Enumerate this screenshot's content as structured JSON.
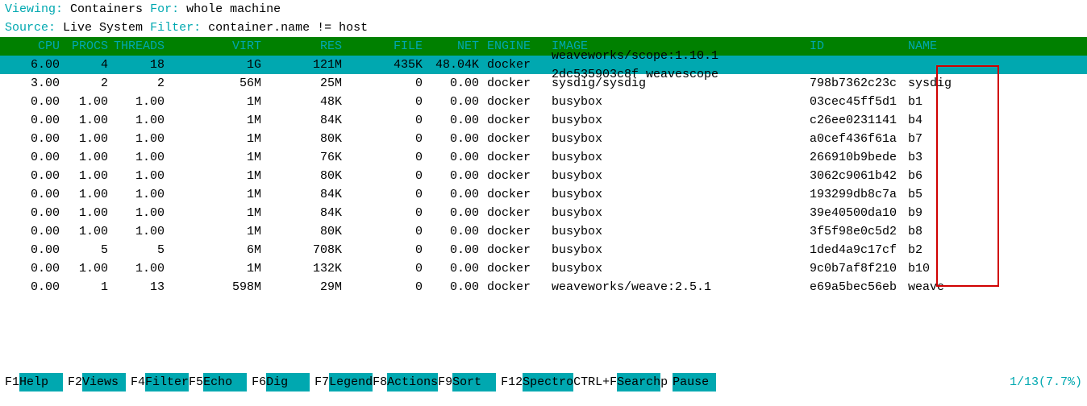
{
  "top": {
    "viewing_label": "Viewing:",
    "viewing_value": "Containers",
    "for_label": "For:",
    "for_value": "whole machine",
    "source_label": "Source:",
    "source_value": "Live System",
    "filter_label": "Filter:",
    "filter_value": "container.name != host"
  },
  "headers": {
    "cpu": "CPU",
    "procs": "PROCS",
    "threads": "THREADS",
    "virt": "VIRT",
    "res": "RES",
    "file": "FILE",
    "net": "NET",
    "engine": "ENGINE",
    "image": "IMAGE",
    "id": "ID",
    "name": "NAME"
  },
  "selected": {
    "cpu": "6.00",
    "procs": "4",
    "threads": "18",
    "virt": "1G",
    "res": "121M",
    "file": "435K",
    "netfile": "48.04K",
    "engine": "docker",
    "image": "weaveworks/scope:1.10.1",
    "id": "2dc535903c8f",
    "name": "weavescope"
  },
  "rows": [
    {
      "cpu": "3.00",
      "procs": "2",
      "threads": "2",
      "virt": "56M",
      "res": "25M",
      "file": "0",
      "net": "0.00",
      "engine": "docker",
      "image": "sysdig/sysdig",
      "id": "798b7362c23c",
      "name": "sysdig"
    },
    {
      "cpu": "0.00",
      "procs": "1.00",
      "threads": "1.00",
      "virt": "1M",
      "res": "48K",
      "file": "0",
      "net": "0.00",
      "engine": "docker",
      "image": "busybox",
      "id": "03cec45ff5d1",
      "name": "b1"
    },
    {
      "cpu": "0.00",
      "procs": "1.00",
      "threads": "1.00",
      "virt": "1M",
      "res": "84K",
      "file": "0",
      "net": "0.00",
      "engine": "docker",
      "image": "busybox",
      "id": "c26ee0231141",
      "name": "b4"
    },
    {
      "cpu": "0.00",
      "procs": "1.00",
      "threads": "1.00",
      "virt": "1M",
      "res": "80K",
      "file": "0",
      "net": "0.00",
      "engine": "docker",
      "image": "busybox",
      "id": "a0cef436f61a",
      "name": "b7"
    },
    {
      "cpu": "0.00",
      "procs": "1.00",
      "threads": "1.00",
      "virt": "1M",
      "res": "76K",
      "file": "0",
      "net": "0.00",
      "engine": "docker",
      "image": "busybox",
      "id": "266910b9bede",
      "name": "b3"
    },
    {
      "cpu": "0.00",
      "procs": "1.00",
      "threads": "1.00",
      "virt": "1M",
      "res": "80K",
      "file": "0",
      "net": "0.00",
      "engine": "docker",
      "image": "busybox",
      "id": "3062c9061b42",
      "name": "b6"
    },
    {
      "cpu": "0.00",
      "procs": "1.00",
      "threads": "1.00",
      "virt": "1M",
      "res": "84K",
      "file": "0",
      "net": "0.00",
      "engine": "docker",
      "image": "busybox",
      "id": "193299db8c7a",
      "name": "b5"
    },
    {
      "cpu": "0.00",
      "procs": "1.00",
      "threads": "1.00",
      "virt": "1M",
      "res": "84K",
      "file": "0",
      "net": "0.00",
      "engine": "docker",
      "image": "busybox",
      "id": "39e40500da10",
      "name": "b9"
    },
    {
      "cpu": "0.00",
      "procs": "1.00",
      "threads": "1.00",
      "virt": "1M",
      "res": "80K",
      "file": "0",
      "net": "0.00",
      "engine": "docker",
      "image": "busybox",
      "id": "3f5f98e0c5d2",
      "name": "b8"
    },
    {
      "cpu": "0.00",
      "procs": "5",
      "threads": "5",
      "virt": "6M",
      "res": "708K",
      "file": "0",
      "net": "0.00",
      "engine": "docker",
      "image": "busybox",
      "id": "1ded4a9c17cf",
      "name": "b2"
    },
    {
      "cpu": "0.00",
      "procs": "1.00",
      "threads": "1.00",
      "virt": "1M",
      "res": "132K",
      "file": "0",
      "net": "0.00",
      "engine": "docker",
      "image": "busybox",
      "id": "9c0b7af8f210",
      "name": "b10"
    },
    {
      "cpu": "0.00",
      "procs": "1",
      "threads": "13",
      "virt": "598M",
      "res": "29M",
      "file": "0",
      "net": "0.00",
      "engine": "docker",
      "image": "weaveworks/weave:2.5.1",
      "id": "e69a5bec56eb",
      "name": "weave"
    }
  ],
  "footer": {
    "f1k": "F1",
    "f1l": "Help",
    "f2k": "F2",
    "f2l": "Views",
    "f4k": "F4",
    "f4l": "Filter",
    "f5k": "F5",
    "f5l": "Echo",
    "f6k": "F6",
    "f6l": "Dig",
    "f7k": "F7",
    "f7l": "Legend",
    "f8k": "F8",
    "f8l": "Actions",
    "f9k": "F9",
    "f9l": "Sort",
    "f12k": "F12",
    "f12l": "Spectro",
    "cfk": "CTRL+F",
    "cfl": "Search",
    "pk": "p",
    "pl": "Pause",
    "pos": "1/13(7.7%)"
  }
}
